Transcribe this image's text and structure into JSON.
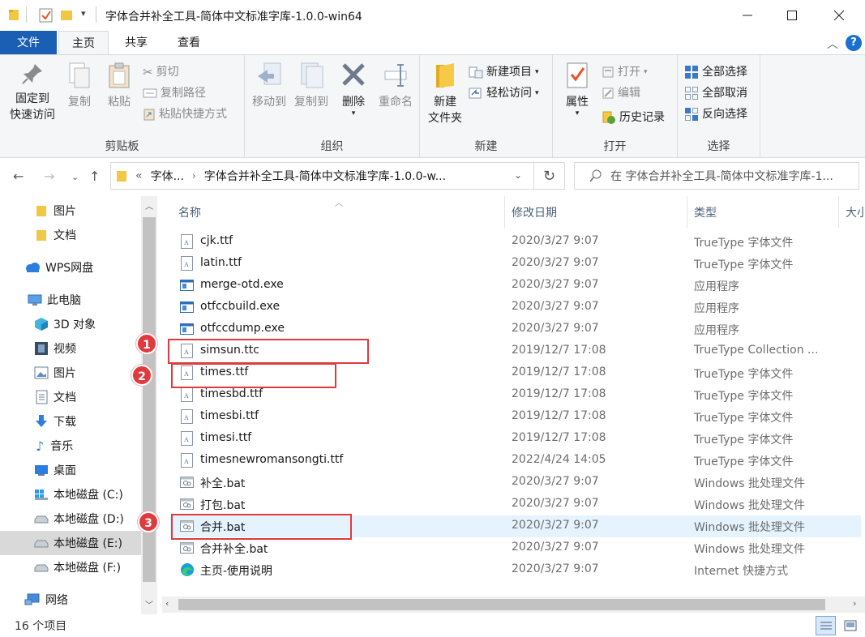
{
  "window": {
    "title": "字体合并补全工具-简体中文标准字库-1.0.0-win64"
  },
  "tabs": {
    "file": "文件",
    "home": "主页",
    "share": "共享",
    "view": "查看"
  },
  "ribbon": {
    "clipboard": {
      "label": "剪贴板",
      "pin_line1": "固定到",
      "pin_line2": "快速访问",
      "copy": "复制",
      "paste": "粘贴",
      "cut": "剪切",
      "copy_path": "复制路径",
      "paste_shortcut": "粘贴快捷方式"
    },
    "organize": {
      "label": "组织",
      "move_to": "移动到",
      "copy_to": "复制到",
      "delete": "删除",
      "rename": "重命名"
    },
    "new": {
      "label": "新建",
      "new_folder_line1": "新建",
      "new_folder_line2": "文件夹",
      "new_item": "新建项目",
      "easy_access": "轻松访问"
    },
    "open": {
      "label": "打开",
      "properties": "属性",
      "open": "打开",
      "edit": "编辑",
      "history": "历史记录"
    },
    "select": {
      "label": "选择",
      "select_all": "全部选择",
      "select_none": "全部取消",
      "invert": "反向选择"
    }
  },
  "address": {
    "prefix": "«",
    "crumb1": "字体...",
    "crumb2": "字体合并补全工具-简体中文标准字库-1.0.0-w...",
    "search_placeholder": "在 字体合并补全工具-简体中文标准字库-1..."
  },
  "nav": {
    "items": [
      {
        "label": "图片"
      },
      {
        "label": "文档"
      },
      {
        "label": "WPS网盘"
      },
      {
        "label": "此电脑"
      },
      {
        "label": "3D 对象"
      },
      {
        "label": "视频"
      },
      {
        "label": "图片"
      },
      {
        "label": "文档"
      },
      {
        "label": "下载"
      },
      {
        "label": "音乐"
      },
      {
        "label": "桌面"
      },
      {
        "label": "本地磁盘 (C:)"
      },
      {
        "label": "本地磁盘 (D:)"
      },
      {
        "label": "本地磁盘 (E:)"
      },
      {
        "label": "本地磁盘 (F:)"
      },
      {
        "label": "网络"
      }
    ]
  },
  "columns": {
    "name": "名称",
    "date": "修改日期",
    "type": "类型",
    "size": "大小"
  },
  "files": [
    {
      "name": "cjk.ttf",
      "date": "2020/3/27 9:07",
      "type": "TrueType 字体文件",
      "icon": "font-file-icon"
    },
    {
      "name": "latin.ttf",
      "date": "2020/3/27 9:07",
      "type": "TrueType 字体文件",
      "icon": "font-file-icon"
    },
    {
      "name": "merge-otd.exe",
      "date": "2020/3/27 9:07",
      "type": "应用程序",
      "icon": "exe-file-icon"
    },
    {
      "name": "otfccbuild.exe",
      "date": "2020/3/27 9:07",
      "type": "应用程序",
      "icon": "exe-file-icon"
    },
    {
      "name": "otfccdump.exe",
      "date": "2020/3/27 9:07",
      "type": "应用程序",
      "icon": "exe-file-icon"
    },
    {
      "name": "simsun.ttc",
      "date": "2019/12/7 17:08",
      "type": "TrueType Collection ...",
      "icon": "font-file-icon"
    },
    {
      "name": "times.ttf",
      "date": "2019/12/7 17:08",
      "type": "TrueType 字体文件",
      "icon": "font-file-icon"
    },
    {
      "name": "timesbd.ttf",
      "date": "2019/12/7 17:08",
      "type": "TrueType 字体文件",
      "icon": "font-file-icon"
    },
    {
      "name": "timesbi.ttf",
      "date": "2019/12/7 17:08",
      "type": "TrueType 字体文件",
      "icon": "font-file-icon"
    },
    {
      "name": "timesi.ttf",
      "date": "2019/12/7 17:08",
      "type": "TrueType 字体文件",
      "icon": "font-file-icon"
    },
    {
      "name": "timesnewromansongti.ttf",
      "date": "2022/4/24 14:05",
      "type": "TrueType 字体文件",
      "icon": "font-file-icon"
    },
    {
      "name": "补全.bat",
      "date": "2020/3/27 9:07",
      "type": "Windows 批处理文件",
      "icon": "bat-file-icon"
    },
    {
      "name": "打包.bat",
      "date": "2020/3/27 9:07",
      "type": "Windows 批处理文件",
      "icon": "bat-file-icon"
    },
    {
      "name": "合并.bat",
      "date": "2020/3/27 9:07",
      "type": "Windows 批处理文件",
      "icon": "bat-file-icon"
    },
    {
      "name": "合并补全.bat",
      "date": "2020/3/27 9:07",
      "type": "Windows 批处理文件",
      "icon": "bat-file-icon"
    },
    {
      "name": "主页-使用说明",
      "date": "2020/3/27 9:07",
      "type": "Internet 快捷方式",
      "icon": "edge-shortcut-icon"
    }
  ],
  "annotations": {
    "badge1": "1",
    "badge2": "2",
    "badge3": "3"
  },
  "status": {
    "count": "16 个项目"
  },
  "colors": {
    "accent": "#1a5fb4",
    "annotation": "#e03a3e",
    "selected_row": "#e5f3ff"
  }
}
